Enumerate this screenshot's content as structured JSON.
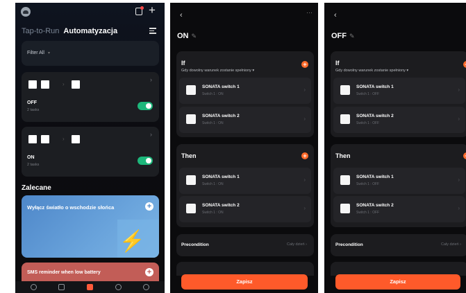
{
  "automations": {
    "tabs": [
      "Tap-to-Run",
      "Automatyzacja"
    ],
    "filter_label": "Filter All",
    "cards": [
      {
        "title": "OFF",
        "subtitle": "2 tasks"
      },
      {
        "title": "ON",
        "subtitle": "2 tasks"
      }
    ],
    "recommended_title": "Zalecane",
    "recommended": [
      {
        "title": "Wyłącz światło o wschodzie słońca"
      },
      {
        "title": "SMS reminder when low battery"
      }
    ],
    "nav": [
      "home-icon",
      "devices-icon",
      "scene-icon",
      "smart-icon",
      "profile-icon"
    ]
  },
  "scene_on": {
    "title": "ON",
    "if_label": "If",
    "if_condition": "Gdy dowolny warunek zostanie spełniony",
    "if_devices": [
      {
        "name": "SONATA switch 1",
        "state": "Switch 1 : ON"
      },
      {
        "name": "SONATA switch 2",
        "state": "Switch 1 : ON"
      }
    ],
    "then_label": "Then",
    "then_devices": [
      {
        "name": "SONATA switch 1",
        "state": "Switch 1 : ON"
      },
      {
        "name": "SONATA switch 2",
        "state": "Switch 1 : ON"
      }
    ],
    "precondition_label": "Precondition",
    "precondition_value": "Cały dzień",
    "save_label": "Zapisz"
  },
  "scene_off": {
    "title": "OFF",
    "if_label": "If",
    "if_condition": "Gdy dowolny warunek zostanie spełniony",
    "if_devices": [
      {
        "name": "SONATA switch 1",
        "state": "Switch 1 : OFF"
      },
      {
        "name": "SONATA switch 2",
        "state": "Switch 1 : OFF"
      }
    ],
    "then_label": "Then",
    "then_devices": [
      {
        "name": "SONATA switch 1",
        "state": "Switch 1 : OFF"
      },
      {
        "name": "SONATA switch 2",
        "state": "Switch 1 : OFF"
      }
    ],
    "precondition_label": "Precondition",
    "precondition_value": "Cały dzień",
    "save_label": "Zapisz"
  },
  "colors": {
    "accent": "#ff5a2a",
    "toggle_on": "#1db77b",
    "card_bg": "#1c1c1f"
  }
}
